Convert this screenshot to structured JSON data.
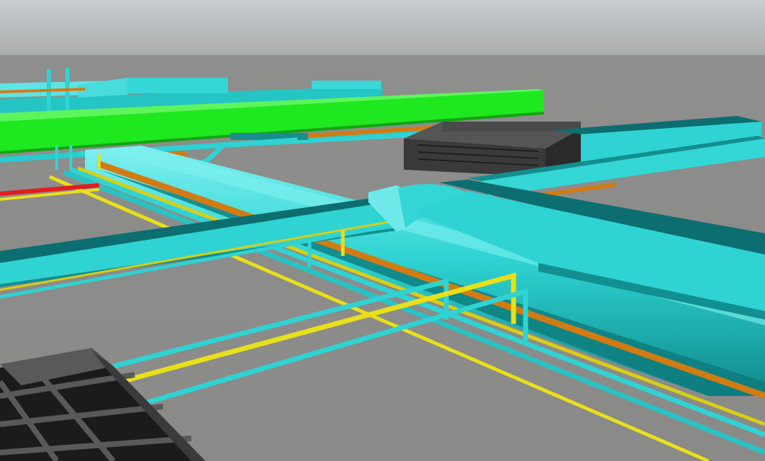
{
  "scene": {
    "description_name": "bim-mep-pipe-duct-model",
    "colors": {
      "sky_top": "#c9cdd0",
      "sky_bottom": "#a9abac",
      "floor": "#8a8a88",
      "floor_far": "#8e8e8c",
      "cyan": "#2fd3d3",
      "cyan_light": "#6fe9ea",
      "cyan_dark": "#128f90",
      "cyan_deep": "#0c6e70",
      "green": "#1ee81e",
      "green_dark": "#11a611",
      "orange": "#d27b12",
      "orange_dark": "#8f5209",
      "yellow": "#e8e01a",
      "yellow_dark": "#9a950c",
      "red": "#e21d1d",
      "black": "#1b1b1b",
      "charcoal": "#3a3a3a",
      "charcoal_light": "#595959"
    }
  }
}
